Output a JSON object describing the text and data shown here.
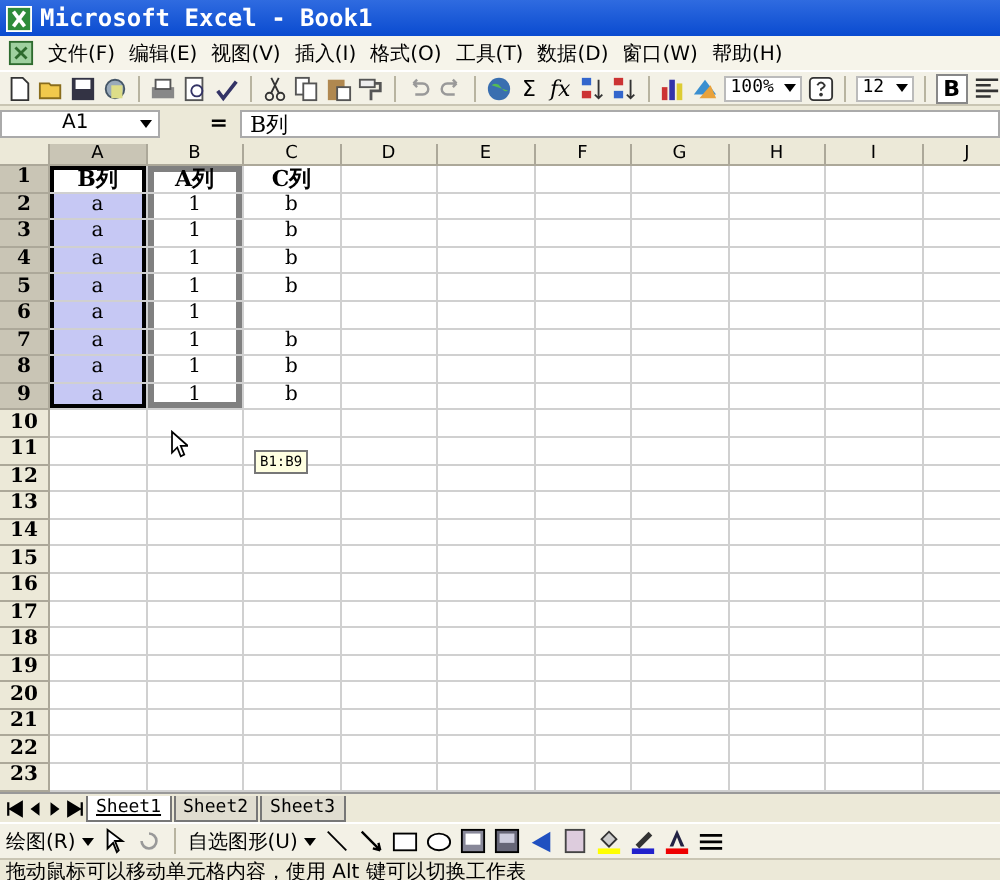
{
  "window": {
    "title": "Microsoft Excel - Book1"
  },
  "menu": [
    {
      "label": "文件(F)"
    },
    {
      "label": "编辑(E)"
    },
    {
      "label": "视图(V)"
    },
    {
      "label": "插入(I)"
    },
    {
      "label": "格式(O)"
    },
    {
      "label": "工具(T)"
    },
    {
      "label": "数据(D)"
    },
    {
      "label": "窗口(W)"
    },
    {
      "label": "帮助(H)"
    }
  ],
  "toolbar": {
    "sum": "Σ",
    "function": "fx",
    "zoom": "100%",
    "font_size": "12",
    "bold": "B"
  },
  "formula_bar": {
    "name_box": "A1",
    "equals": "=",
    "value": "B列"
  },
  "columns": [
    "A",
    "B",
    "C",
    "D",
    "E",
    "F",
    "G",
    "H",
    "I",
    "J"
  ],
  "rows": [
    {
      "header": "1",
      "cells": [
        {
          "text": "B列",
          "bold": true,
          "selected": true,
          "active": true,
          "outlined": false
        },
        {
          "text": "A列",
          "bold": true,
          "selected": false,
          "outlined": true
        },
        {
          "text": "C列",
          "bold": true,
          "selected": false,
          "outlined": false
        }
      ]
    },
    {
      "header": "2",
      "cells": [
        {
          "text": "a",
          "selected": true,
          "active": false,
          "outlined": false
        },
        {
          "text": "1",
          "selected": false,
          "outlined": true
        },
        {
          "text": "b",
          "selected": false,
          "outlined": false
        }
      ]
    },
    {
      "header": "3",
      "cells": [
        {
          "text": "a",
          "selected": true,
          "active": false,
          "outlined": false
        },
        {
          "text": "1",
          "selected": false,
          "outlined": true
        },
        {
          "text": "b",
          "selected": false,
          "outlined": false
        }
      ]
    },
    {
      "header": "4",
      "cells": [
        {
          "text": "a",
          "selected": true,
          "active": false,
          "outlined": false
        },
        {
          "text": "1",
          "selected": false,
          "outlined": true
        },
        {
          "text": "b",
          "selected": false,
          "outlined": false
        }
      ]
    },
    {
      "header": "5",
      "cells": [
        {
          "text": "a",
          "selected": true,
          "active": false,
          "outlined": false
        },
        {
          "text": "1",
          "selected": false,
          "outlined": true
        },
        {
          "text": "b",
          "selected": false,
          "outlined": false
        }
      ]
    },
    {
      "header": "6",
      "cells": [
        {
          "text": "a",
          "selected": true,
          "active": false,
          "outlined": false
        },
        {
          "text": "1",
          "selected": false,
          "outlined": true
        }
      ]
    },
    {
      "header": "7",
      "cells": [
        {
          "text": "a",
          "selected": true,
          "active": false,
          "outlined": false
        },
        {
          "text": "1",
          "selected": false,
          "outlined": true
        },
        {
          "text": "b",
          "selected": false,
          "outlined": false
        }
      ]
    },
    {
      "header": "8",
      "cells": [
        {
          "text": "a",
          "selected": true,
          "active": false,
          "outlined": false
        },
        {
          "text": "1",
          "selected": false,
          "outlined": true
        },
        {
          "text": "b",
          "selected": false,
          "outlined": false
        }
      ]
    },
    {
      "header": "9",
      "cells": [
        {
          "text": "a",
          "selected": true,
          "active": false,
          "outlined": false
        },
        {
          "text": "1",
          "selected": false,
          "outlined": true
        },
        {
          "text": "b",
          "selected": false,
          "outlined": false
        }
      ]
    },
    {
      "header": "10"
    },
    {
      "header": "11"
    },
    {
      "header": "12"
    },
    {
      "header": "13"
    },
    {
      "header": "14"
    },
    {
      "header": "15"
    },
    {
      "header": "16"
    },
    {
      "header": "17"
    },
    {
      "header": "18"
    },
    {
      "header": "19"
    },
    {
      "header": "20"
    },
    {
      "header": "21"
    },
    {
      "header": "22"
    },
    {
      "header": "23"
    }
  ],
  "drag_tooltip": "B1:B9",
  "sheet_tabs": [
    {
      "label": "Sheet1",
      "selected": true
    },
    {
      "label": "Sheet2",
      "selected": false
    },
    {
      "label": "Sheet3",
      "selected": false
    }
  ],
  "drawing_toolbar": {
    "draw": "绘图(R)",
    "autoshapes": "自选图形(U)"
  },
  "status_bar": "拖动鼠标可以移动单元格内容，使用 Alt 键可以切换工作表"
}
